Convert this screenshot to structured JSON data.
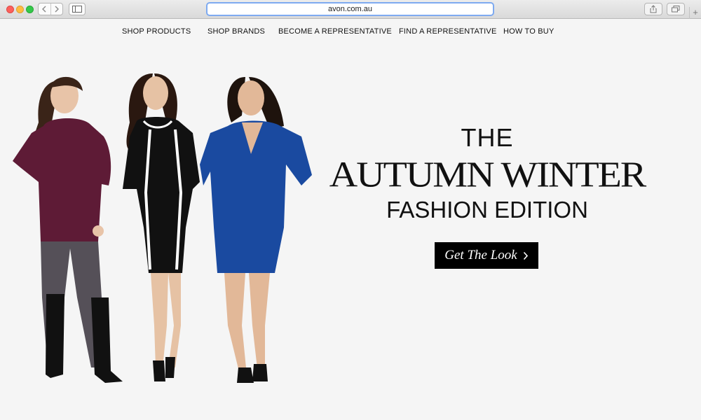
{
  "browser": {
    "url": "avon.com.au",
    "new_tab_label": "+"
  },
  "nav": {
    "items": [
      {
        "label": "SHOP PRODUCTS"
      },
      {
        "label": "SHOP BRANDS"
      },
      {
        "label": "BECOME A REPRESENTATIVE"
      },
      {
        "label": "FIND A REPRESENTATIVE"
      },
      {
        "label": "HOW TO BUY"
      }
    ]
  },
  "hero": {
    "line1": "THE",
    "line2": "AUTUMN WINTER",
    "line3": "FASHION EDITION",
    "cta_label": "Get The Look",
    "cta_icon": "chevron-right-icon"
  },
  "colors": {
    "background": "#f5f5f5",
    "cta_bg": "#000000",
    "model1_top": "#5e1b36",
    "model2_dress": "#111111",
    "model3_dress": "#1a4aa0"
  }
}
